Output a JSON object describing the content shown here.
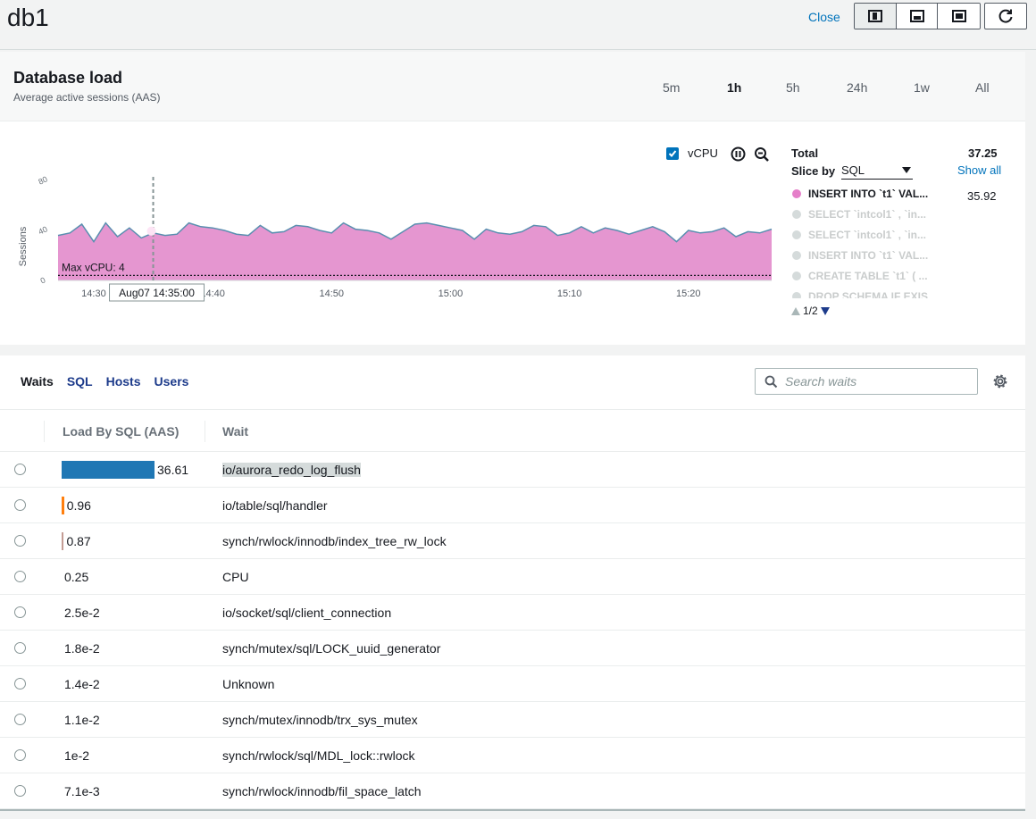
{
  "window": {
    "title": "db1",
    "close_label": "Close"
  },
  "layout_buttons": [
    {
      "name": "layout-side-icon",
      "active": true
    },
    {
      "name": "layout-bottom-icon",
      "active": false
    },
    {
      "name": "layout-full-icon",
      "active": false
    }
  ],
  "db_load": {
    "title": "Database load",
    "subtitle": "Average active sessions (AAS)",
    "ranges": [
      "5m",
      "1h",
      "5h",
      "24h",
      "1w",
      "All"
    ],
    "active_range": "1h",
    "vcpu_label": "vCPU",
    "vcpu_checked": true
  },
  "chart_data": {
    "type": "area",
    "ylabel": "Sessions",
    "ylim": [
      0,
      80
    ],
    "y_ticks": [
      "0",
      "40",
      "80"
    ],
    "x_ticks": [
      "14:30",
      "14:40",
      "14:50",
      "15:00",
      "15:10",
      "15:20"
    ],
    "x_start_minutes": 0,
    "x_end_minutes": 60,
    "x_tick_minutes": [
      3,
      13,
      23,
      33,
      43,
      53
    ],
    "max_vcpu_label": "Max vCPU: 4",
    "max_vcpu": 4,
    "tooltip": "Aug07 14:35:00",
    "tooltip_minute": 8,
    "fill_color": "#e596d0",
    "line_color": "#5a8fb0",
    "series": [
      {
        "values": [
          36,
          38,
          45,
          31,
          46,
          35,
          42,
          34,
          38,
          36,
          37,
          46,
          43,
          42,
          40,
          37,
          36,
          44,
          38,
          39,
          44,
          43,
          40,
          38,
          46,
          41,
          40,
          38,
          33,
          39,
          45,
          46,
          44,
          42,
          40,
          33,
          41,
          38,
          37,
          39,
          44,
          43,
          36,
          38,
          43,
          38,
          42,
          40,
          37,
          40,
          43,
          39,
          31,
          40,
          38,
          39,
          42,
          35,
          39,
          38,
          41
        ]
      }
    ]
  },
  "legend": {
    "total_label": "Total",
    "total_value": "37.25",
    "slice_label": "Slice by",
    "slice_value": "SQL",
    "show_all": "Show all",
    "items": [
      {
        "text": "INSERT INTO `t1` VAL...",
        "value": "35.92",
        "color": "#e57fc9",
        "dim": false
      },
      {
        "text": "SELECT `intcol1` , `in...",
        "value": "",
        "color": "#d5dbdb",
        "dim": true
      },
      {
        "text": "SELECT `intcol1` , `in...",
        "value": "",
        "color": "#d5dbdb",
        "dim": true
      },
      {
        "text": "INSERT INTO `t1` VAL...",
        "value": "",
        "color": "#d5dbdb",
        "dim": true
      },
      {
        "text": "CREATE TABLE `t1` ( ...",
        "value": "",
        "color": "#d5dbdb",
        "dim": true
      },
      {
        "text": "DROP SCHEMA IF EXIS...",
        "value": "",
        "color": "#d5dbdb",
        "dim": true
      }
    ],
    "pager": "1/2"
  },
  "dimensions": {
    "tabs": [
      "Waits",
      "SQL",
      "Hosts",
      "Users"
    ],
    "active_tab": "Waits",
    "search_placeholder": "Search waits",
    "col_load": "Load By SQL (AAS)",
    "col_wait": "Wait",
    "max_load": 36.61,
    "rows": [
      {
        "value": 36.61,
        "label": "36.61",
        "wait": "io/aurora_redo_log_flush",
        "color": "#1f77b4",
        "highlight": true
      },
      {
        "value": 0.96,
        "label": "0.96",
        "wait": "io/table/sql/handler",
        "color": "#ff7f0e",
        "highlight": false
      },
      {
        "value": 0.87,
        "label": "0.87",
        "wait": "synch/rwlock/innodb/index_tree_rw_lock",
        "color": "#c49c94",
        "highlight": false
      },
      {
        "value": 0.25,
        "label": "0.25",
        "wait": "CPU",
        "color": "#9b5870",
        "highlight": false
      },
      {
        "value": 0.025,
        "label": "2.5e-2",
        "wait": "io/socket/sql/client_connection",
        "color": "#aec7e8",
        "highlight": false
      },
      {
        "value": 0.018,
        "label": "1.8e-2",
        "wait": "synch/mutex/sql/LOCK_uuid_generator",
        "color": "#aec7e8",
        "highlight": false
      },
      {
        "value": 0.014,
        "label": "1.4e-2",
        "wait": "Unknown",
        "color": "#aec7e8",
        "highlight": false
      },
      {
        "value": 0.011,
        "label": "1.1e-2",
        "wait": "synch/mutex/innodb/trx_sys_mutex",
        "color": "#aec7e8",
        "highlight": false
      },
      {
        "value": 0.01,
        "label": "1e-2",
        "wait": "synch/rwlock/sql/MDL_lock::rwlock",
        "color": "#aec7e8",
        "highlight": false
      },
      {
        "value": 0.0071,
        "label": "7.1e-3",
        "wait": "synch/rwlock/innodb/fil_space_latch",
        "color": "#aec7e8",
        "highlight": false
      }
    ]
  }
}
